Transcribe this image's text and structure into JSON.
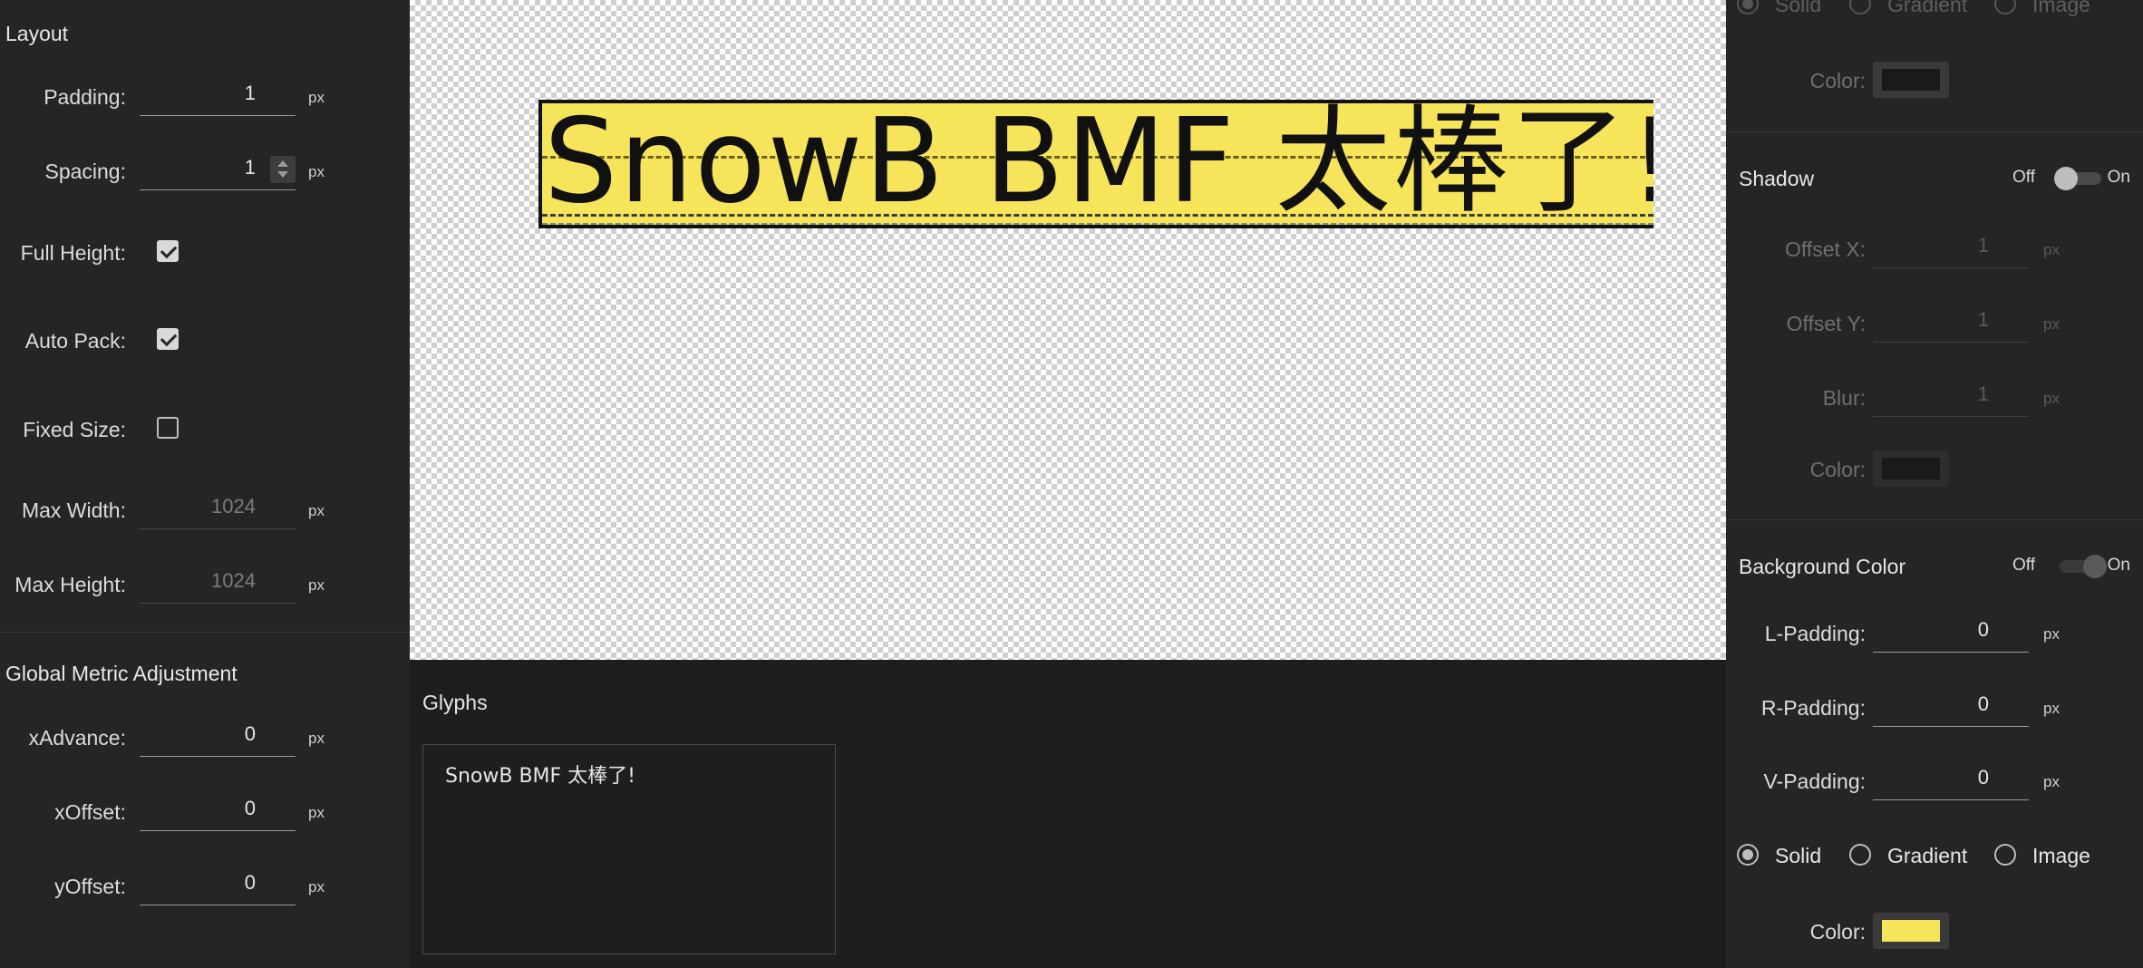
{
  "layout": {
    "title": "Layout",
    "padding": {
      "label": "Padding:",
      "value": "1",
      "unit": "px"
    },
    "spacing": {
      "label": "Spacing:",
      "value": "1",
      "unit": "px"
    },
    "full_height": {
      "label": "Full Height:",
      "checked": true
    },
    "auto_pack": {
      "label": "Auto Pack:",
      "checked": true
    },
    "fixed_size": {
      "label": "Fixed Size:",
      "checked": false
    },
    "max_width": {
      "label": "Max Width:",
      "value": "1024",
      "unit": "px"
    },
    "max_height": {
      "label": "Max Height:",
      "value": "1024",
      "unit": "px"
    }
  },
  "metric": {
    "title": "Global Metric Adjustment",
    "x_advance": {
      "label": "xAdvance:",
      "value": "0",
      "unit": "px"
    },
    "x_offset": {
      "label": "xOffset:",
      "value": "0",
      "unit": "px"
    },
    "y_offset": {
      "label": "yOffset:",
      "value": "0",
      "unit": "px"
    }
  },
  "canvas": {
    "preview_text": "SnowB BMF 太棒了!",
    "background_color": "#f6e45a"
  },
  "glyphs": {
    "title": "Glyphs",
    "text": "SnowB BMF 太棒了!"
  },
  "fill_top": {
    "options": [
      "Solid",
      "Gradient",
      "Image"
    ],
    "selected": "Solid",
    "color_label": "Color:",
    "color": "#1a1a1a"
  },
  "shadow": {
    "title": "Shadow",
    "toggle_off": "Off",
    "toggle_on": "On",
    "enabled": false,
    "offset_x": {
      "label": "Offset X:",
      "value": "1",
      "unit": "px"
    },
    "offset_y": {
      "label": "Offset Y:",
      "value": "1",
      "unit": "px"
    },
    "blur": {
      "label": "Blur:",
      "value": "1",
      "unit": "px"
    },
    "color_label": "Color:",
    "color": "#1a1a1a"
  },
  "background": {
    "title": "Background Color",
    "toggle_off": "Off",
    "toggle_on": "On",
    "enabled": true,
    "l_padding": {
      "label": "L-Padding:",
      "value": "0",
      "unit": "px"
    },
    "r_padding": {
      "label": "R-Padding:",
      "value": "0",
      "unit": "px"
    },
    "v_padding": {
      "label": "V-Padding:",
      "value": "0",
      "unit": "px"
    },
    "options": [
      "Solid",
      "Gradient",
      "Image"
    ],
    "selected": "Solid",
    "color_label": "Color:",
    "color": "#f6e45a"
  }
}
